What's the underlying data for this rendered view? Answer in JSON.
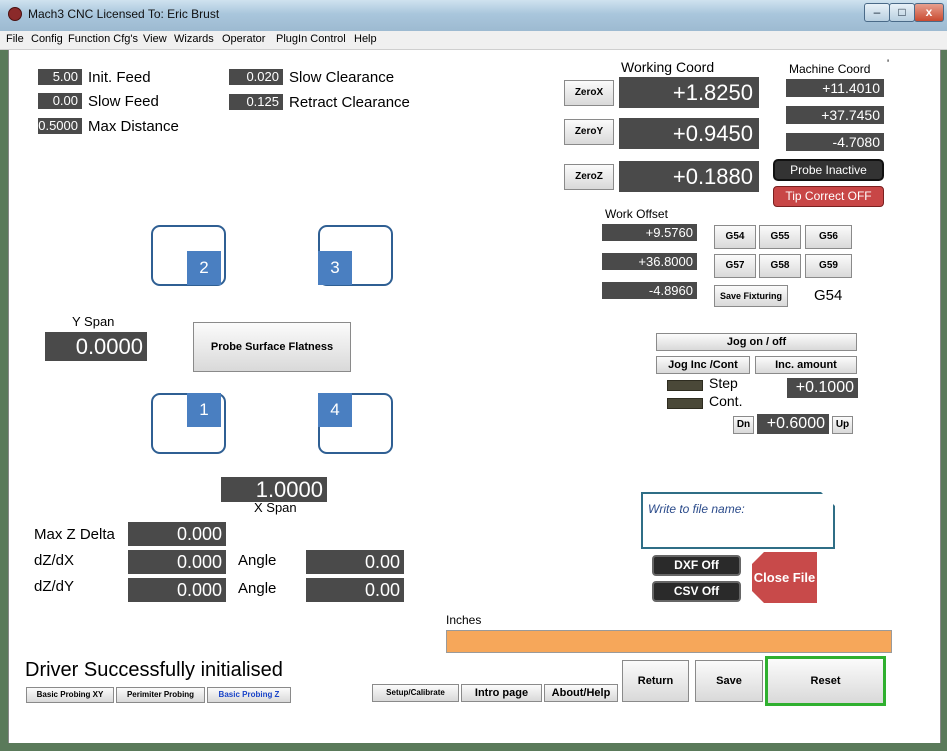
{
  "window": {
    "title": "Mach3 CNC  Licensed To: Eric Brust",
    "minimize": "–",
    "maximize": "□",
    "close": "x"
  },
  "menu": [
    "File",
    "Config",
    "Function Cfg's",
    "View",
    "Wizards",
    "Operator",
    "PlugIn Control",
    "Help"
  ],
  "params": {
    "init_feed": {
      "value": "5.00",
      "label": "Init. Feed"
    },
    "slow_feed": {
      "value": "0.00",
      "label": "Slow Feed"
    },
    "max_distance": {
      "value": "0.5000",
      "label": "Max Distance"
    },
    "slow_clearance": {
      "value": "0.020",
      "label": "Slow Clearance"
    },
    "retract_clearance": {
      "value": "0.125",
      "label": "Retract Clearance"
    }
  },
  "working_coord": {
    "title": "Working Coord",
    "x": "+1.8250",
    "y": "+0.9450",
    "z": "+0.1880",
    "zero_x": "ZeroX",
    "zero_y": "ZeroY",
    "zero_z": "ZeroZ"
  },
  "machine_coord": {
    "title": "Machine Coord",
    "x": "+11.4010",
    "y": "+37.7450",
    "z": "-4.7080",
    "mark": "'"
  },
  "probe_status": "Probe Inactive",
  "tip_correct": "Tip Correct OFF",
  "work_offset": {
    "title": "Work Offset",
    "x": "+9.5760",
    "y": "+36.8000",
    "z": "-4.8960"
  },
  "fixtures": [
    "G54",
    "G55",
    "G56",
    "G57",
    "G58",
    "G59"
  ],
  "save_fixturing": "Save Fixturing",
  "current_fixture": "G54",
  "probe_points": [
    "2",
    "3",
    "1",
    "4"
  ],
  "y_span": {
    "label": "Y Span",
    "value": "0.0000"
  },
  "x_span": {
    "label": "X Span",
    "value": "1.0000"
  },
  "probe_button": "Probe Surface Flatness",
  "jog": {
    "toggle": "Jog on / off",
    "inc_cont": "Jog Inc /Cont",
    "inc_amount_label": "Inc. amount",
    "step": "Step",
    "cont": "Cont.",
    "inc_value": "+0.1000",
    "dn": "Dn",
    "up": "Up",
    "dn_up_value": "+0.6000"
  },
  "results": {
    "max_z_delta": {
      "label": "Max Z Delta",
      "value": "0.000"
    },
    "dzdx": {
      "label": "dZ/dX",
      "value": "0.000",
      "angle_label": "Angle",
      "angle": "0.00"
    },
    "dzdy": {
      "label": "dZ/dY",
      "value": "0.000",
      "angle_label": "Angle",
      "angle": "0.00"
    }
  },
  "file": {
    "placeholder": "Write to file name:",
    "dxf": "DXF Off",
    "csv": "CSV Off",
    "close": "Close File"
  },
  "units_label": "Inches",
  "status_message": "Driver Successfully initialised",
  "tabs": [
    "Basic Probing XY",
    "Perimiter Probing",
    "Basic Probing Z"
  ],
  "nav": {
    "setup": "Setup/Calibrate",
    "intro": "Intro page",
    "about": "About/Help",
    "return": "Return",
    "save": "Save",
    "reset": "Reset"
  },
  "colors": {
    "dro_bg": "#4a4a4a",
    "probe_box": "#4a7fc1",
    "tip_correct": "#c84646",
    "close_file": "#c84a4a",
    "progress": "#f6a75a",
    "file_box_border": "#2f6e86"
  }
}
